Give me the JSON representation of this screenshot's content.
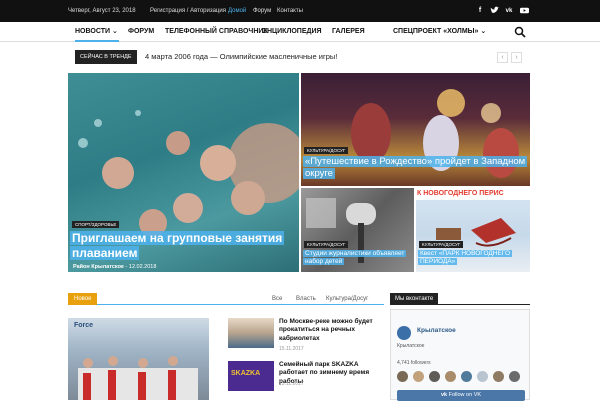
{
  "topbar": {
    "date": "Четверг, Август 23, 2018",
    "auth": "Регистрация / Авторизация",
    "links": [
      "Домой",
      "Форум",
      "Контакты"
    ],
    "social": [
      "facebook-icon",
      "twitter-icon",
      "vk-icon",
      "youtube-icon"
    ]
  },
  "nav": {
    "items": [
      "НОВОСТИ",
      "ФОРУМ",
      "ТЕЛЕФОННЫЙ СПРАВОЧНИК",
      "ЭНЦИКЛОПЕДИЯ",
      "ГАЛЕРЕЯ",
      "СПЕЦПРОЕКТ «ХОЛМЫ»"
    ]
  },
  "trending": {
    "label": "СЕЙЧАС В ТРЕНДЕ",
    "headline": "4 марта 2006 года — Олимпийские масленичные игры!"
  },
  "featured": {
    "main": {
      "category": "СПОРТ/ЗДОРОВЬЕ",
      "title": "Приглашаем на групповые занятия плаванием",
      "author": "Район Крылатское",
      "date": "12.02.2018"
    },
    "top_right": {
      "category": "КУЛЬТУРА/ДОСУГ",
      "title": "«Путешествие в Рождество» пройдет в Западном округе"
    },
    "bottom_left": {
      "category": "КУЛЬТУРА/ДОСУГ",
      "title": "Студии журналистики объявляет набор детей"
    },
    "bottom_right": {
      "category": "КУЛЬТУРА/ДОСУГ",
      "title": "Квест «ПАРК НОВОГОДНЕГО ПЕРИОДА»",
      "banner": "К НОВОГОДНЕГО ПЕРИС"
    }
  },
  "news_block": {
    "tab": "Новое",
    "filters": [
      "Все",
      "Власть",
      "Культура/Досуг"
    ],
    "photo_caption": "Force",
    "items": [
      {
        "title": "По Москве-реке можно будет прокатиться на речных кабриолетах",
        "date": "15.11.2017"
      },
      {
        "title": "Семейный парк SKAZKA работает по зимнему время работы",
        "date": "15.11.2017",
        "logo": "SKAZKA"
      }
    ]
  },
  "vk_widget": {
    "header": "Мы вконтакте",
    "group": "Крылатское",
    "subtitle": "Крылатское",
    "followers": "4,741 followers",
    "follow_label": "Follow on VK"
  },
  "colors": {
    "accent": "#4db2ec",
    "tab": "#e8a10d",
    "dark": "#111111"
  }
}
